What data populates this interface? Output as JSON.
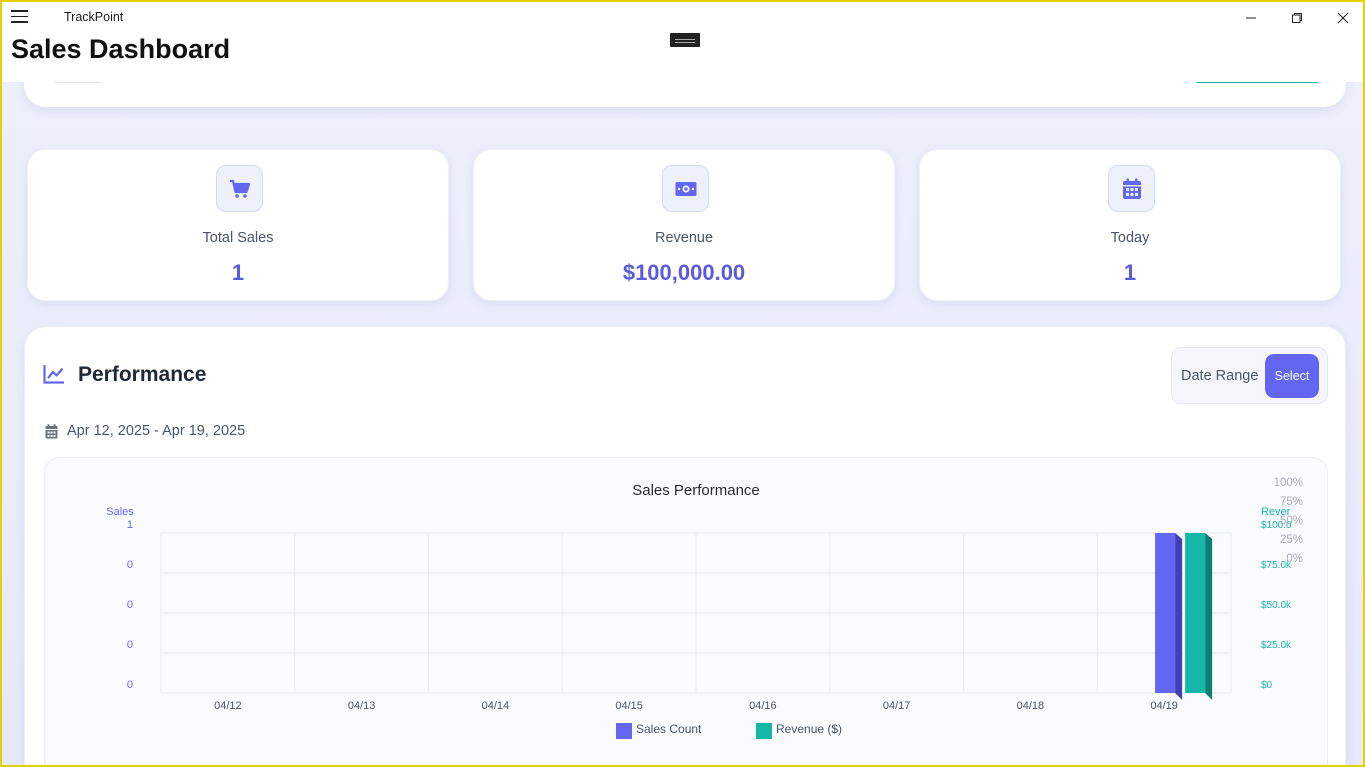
{
  "window": {
    "app_name": "TrackPoint",
    "page_title": "Sales Dashboard"
  },
  "stats": [
    {
      "label": "Total Sales",
      "value": "1",
      "icon": "cart-icon"
    },
    {
      "label": "Revenue",
      "value": "$100,000.00",
      "icon": "money-bill-icon"
    },
    {
      "label": "Today",
      "value": "1",
      "icon": "calendar-icon"
    }
  ],
  "performance": {
    "title": "Performance",
    "date_range_label": "Date Range",
    "select_label": "Select",
    "date_range_text": "Apr 12, 2025 - Apr 19, 2025"
  },
  "colors": {
    "accent": "#6366f1",
    "teal": "#14b8a6",
    "value": "#5b5be0"
  },
  "chart_data": {
    "type": "bar",
    "title": "Sales Performance",
    "categories": [
      "04/12",
      "04/13",
      "04/14",
      "04/15",
      "04/16",
      "04/17",
      "04/18",
      "04/19"
    ],
    "series": [
      {
        "name": "Sales Count",
        "axis": "left",
        "color": "#6366f1",
        "values": [
          0,
          0,
          0,
          0,
          0,
          0,
          0,
          1
        ]
      },
      {
        "name": "Revenue ($)",
        "axis": "right",
        "color": "#14b8a6",
        "values": [
          0,
          0,
          0,
          0,
          0,
          0,
          0,
          100000
        ]
      }
    ],
    "y_left": {
      "label": "Sales",
      "ticks": [
        "1",
        "0",
        "0",
        "0",
        "0"
      ],
      "ylim": [
        0,
        1
      ]
    },
    "y_right": {
      "label": "Rever",
      "ticks": [
        "$100.0",
        "$75.0k",
        "$50.0k",
        "$25.0k",
        "$0"
      ],
      "ylim": [
        0,
        100000
      ]
    },
    "overlay_ticks": [
      "100%",
      "75%",
      "50%",
      "25%",
      "0%"
    ],
    "grid": true,
    "legend_position": "bottom"
  }
}
